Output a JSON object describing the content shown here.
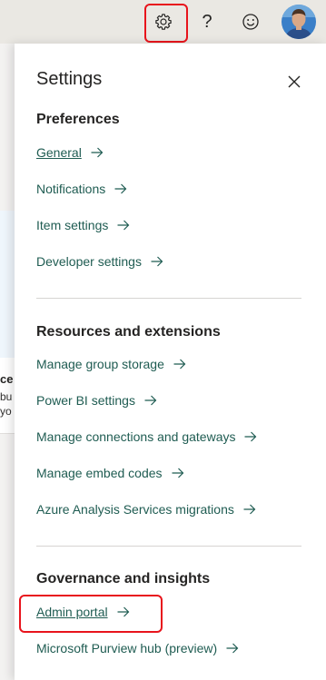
{
  "header": {
    "settings_icon": "gear-icon",
    "help_label": "?",
    "feedback_icon": "smiley-icon",
    "avatar_icon": "user-avatar"
  },
  "background_page": {
    "fragment_1": "ce",
    "fragment_2": "bu",
    "fragment_3": "yo"
  },
  "settings": {
    "title": "Settings",
    "sections": [
      {
        "heading": "Preferences",
        "items": [
          {
            "label": "General"
          },
          {
            "label": "Notifications"
          },
          {
            "label": "Item settings"
          },
          {
            "label": "Developer settings"
          }
        ]
      },
      {
        "heading": "Resources and extensions",
        "items": [
          {
            "label": "Manage group storage"
          },
          {
            "label": "Power BI settings"
          },
          {
            "label": "Manage connections and gateways"
          },
          {
            "label": "Manage embed codes"
          },
          {
            "label": "Azure Analysis Services migrations"
          }
        ]
      },
      {
        "heading": "Governance and insights",
        "items": [
          {
            "label": "Admin portal"
          },
          {
            "label": "Microsoft Purview hub (preview)"
          }
        ]
      }
    ]
  },
  "colors": {
    "link": "#1f5c52",
    "highlight": "#e8141c",
    "topbar": "#eae8e3"
  }
}
